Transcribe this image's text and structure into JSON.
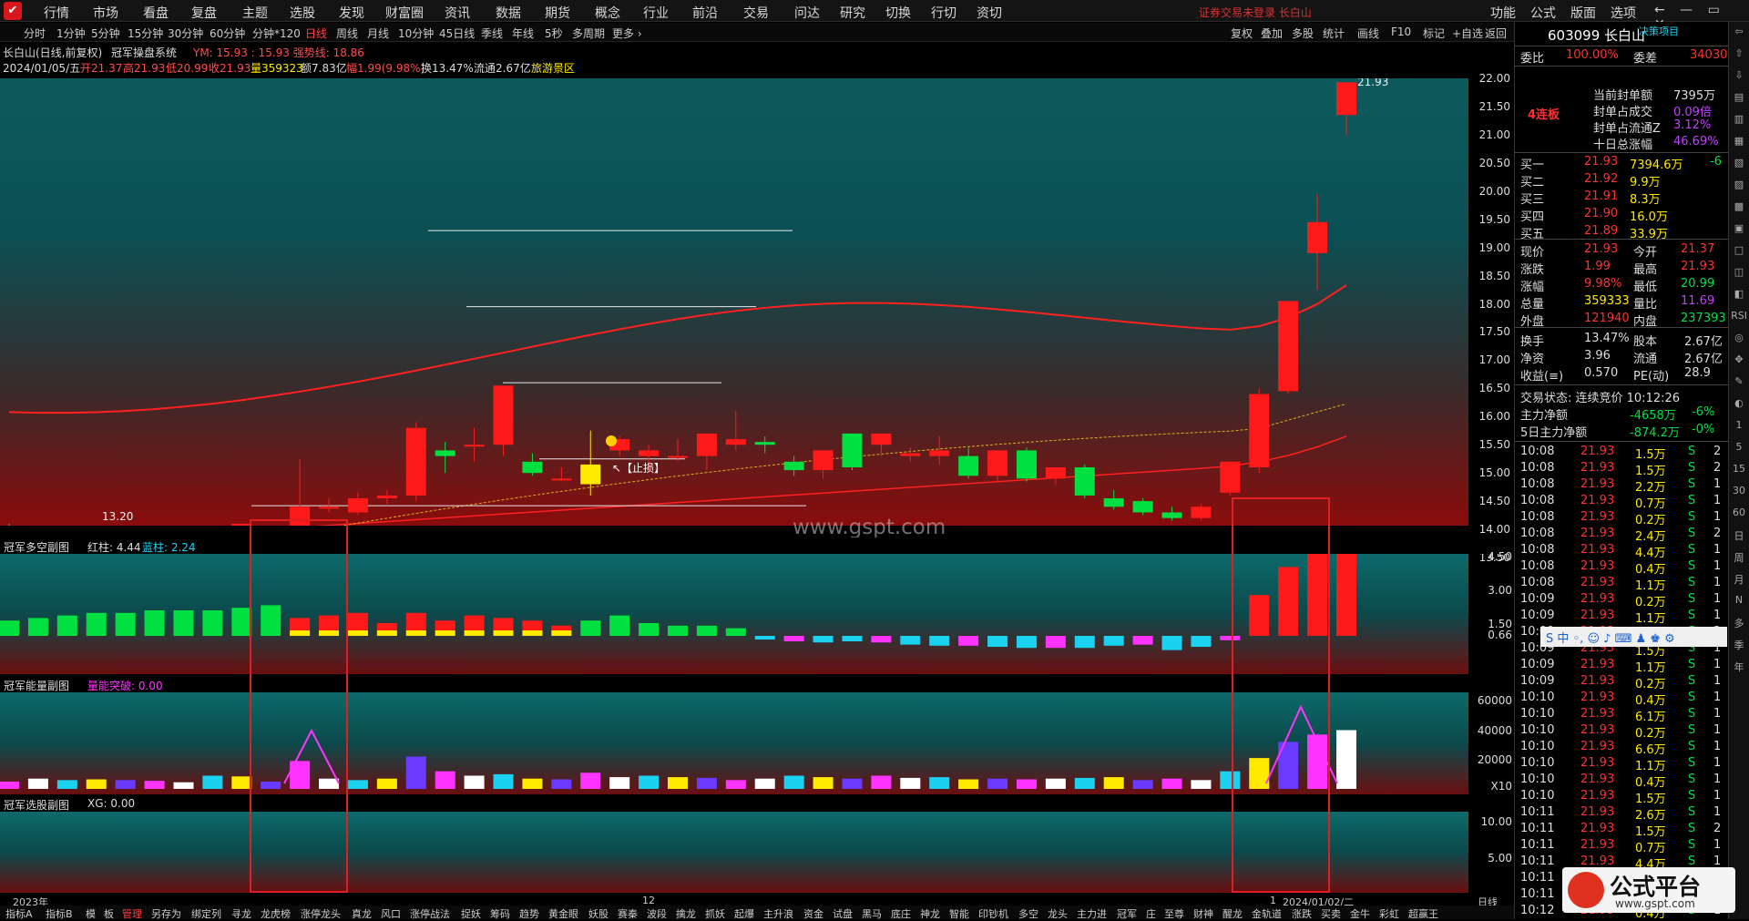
{
  "menu": {
    "logo": "✔",
    "items": [
      "行情",
      "市场",
      "看盘",
      "复盘",
      "主题",
      "选股",
      "发现",
      "财富圈",
      "资讯",
      "数据",
      "期货",
      "概念",
      "行业",
      "前沿",
      "交易",
      "问达",
      "研究",
      "切换",
      "行切",
      "资切"
    ],
    "login_warning": "证券交易未登录 长白山",
    "right_items": [
      "功能",
      "公式",
      "版面",
      "选项"
    ],
    "window_controls": "← — ▭ ✕"
  },
  "periods": [
    "分时",
    "1分钟",
    "5分钟",
    "15分钟",
    "30分钟",
    "60分钟",
    "分钟*120",
    "日线",
    "周线",
    "月线",
    "10分钟",
    "45日线",
    "季线",
    "年线",
    "5秒",
    "多周期",
    "更多 ›"
  ],
  "period_active": "日线",
  "toolbar_right": [
    "复权",
    "叠加",
    "多股",
    "统计",
    "画线",
    "F10",
    "标记",
    "+自选",
    "返回"
  ],
  "chart_title": "长白山(日线,前复权)",
  "system_name": "冠军操盘系统",
  "ym_text": "YM: 15.93 : 15.93 强势线: 18.86",
  "ohlc": {
    "date": "2024/01/05/五",
    "open": "开21.37",
    "high": "高21.93",
    "low": "低20.99",
    "close": "收21.93",
    "vol": "量359323",
    "amt": "额7.83亿",
    "chg": "幅1.99(9.98%)",
    "turn": "换13.47%",
    "float": "流通2.67亿",
    "sector": "旅游景区"
  },
  "yaxis": [
    "22.00",
    "21.50",
    "21.00",
    "20.50",
    "20.00",
    "19.50",
    "19.00",
    "18.50",
    "18.00",
    "17.50",
    "17.00",
    "16.50",
    "16.00",
    "15.50",
    "15.00",
    "14.50",
    "14.00",
    "13.50"
  ],
  "annot": {
    "max": "21.93",
    "min": "13.20",
    "stop": "↖【止损】",
    "watermark": "www.gspt.com"
  },
  "sub1": {
    "name": "冠军多空副图",
    "red": "红柱: 4.44",
    "blue": "蓝柱: 2.24",
    "y": [
      "4.50",
      "3.00",
      "1.50",
      "0.66"
    ]
  },
  "sub2": {
    "name": "冠军能量副图",
    "label": "量能突破: 0.00",
    "y": [
      "60000",
      "40000",
      "20000",
      "X10"
    ]
  },
  "sub3": {
    "name": "冠军选股副图",
    "label": "XG: 0.00",
    "y": [
      "10.00",
      "5.00"
    ]
  },
  "time_labels": [
    "2023年",
    "12",
    "1",
    "2024/01/02/二"
  ],
  "time_label_right": "日线",
  "tabs": [
    "指标A",
    "指标B",
    "模",
    "板",
    "管理",
    "另存为",
    "绑定列",
    "寻龙",
    "龙虎榜",
    "涨停龙头",
    "真龙",
    "风口",
    "涨停战法",
    "捉妖",
    "筹码",
    "趋势",
    "黄金眼",
    "妖股",
    "赛秦",
    "波段",
    "擒龙",
    "抓妖",
    "起爆",
    "主升浪",
    "资金",
    "试盘",
    "黑马",
    "底庄",
    "神龙",
    "智能",
    "印钞机",
    "多空",
    "龙头",
    "主力进",
    "冠军",
    "庄",
    "至尊",
    "财神",
    "醒龙",
    "金轨道",
    "涨跌",
    "买卖",
    "金牛",
    "彩虹",
    "超赢王"
  ],
  "side": {
    "code": "603099 长白山",
    "tag": "决策项目",
    "wb_label": "委比",
    "wb": "100.00%",
    "wc_label": "委差",
    "wc": "34030",
    "lb": "4连板",
    "seal": [
      [
        "当前封单额",
        "7395万"
      ],
      [
        "封单占成交",
        "0.09倍"
      ],
      [
        "封单占流通Z",
        "3.12%"
      ],
      [
        "十日总涨幅",
        "46.69%"
      ]
    ],
    "buys": [
      [
        "买一",
        "21.93",
        "7394.6万",
        "-6"
      ],
      [
        "买二",
        "21.92",
        "9.9万",
        ""
      ],
      [
        "买三",
        "21.91",
        "8.3万",
        ""
      ],
      [
        "买四",
        "21.90",
        "16.0万",
        ""
      ],
      [
        "买五",
        "21.89",
        "33.9万",
        ""
      ]
    ],
    "quote": [
      [
        "现价",
        "21.93",
        "今开",
        "21.37"
      ],
      [
        "涨跌",
        "1.99",
        "最高",
        "21.93"
      ],
      [
        "涨幅",
        "9.98%",
        "最低",
        "20.99"
      ],
      [
        "总量",
        "359333",
        "量比",
        "11.69"
      ],
      [
        "外盘",
        "121940",
        "内盘",
        "237393"
      ]
    ],
    "fin": [
      [
        "换手",
        "13.47%",
        "股本",
        "2.67亿"
      ],
      [
        "净资",
        "3.96",
        "流通",
        "2.67亿"
      ],
      [
        "收益(≡)",
        "0.570",
        "PE(动)",
        "28.9"
      ]
    ],
    "status": "交易状态: 连续竞价 10:12:26",
    "flows": [
      [
        "主力净额",
        "-4658万",
        "-6%"
      ],
      [
        "5日主力净额",
        "-874.2万",
        "-0%"
      ]
    ],
    "ticks": [
      [
        "10:08",
        "21.93",
        "1.5万",
        "S",
        "2"
      ],
      [
        "10:08",
        "21.93",
        "1.5万",
        "S",
        "2"
      ],
      [
        "10:08",
        "21.93",
        "2.2万",
        "S",
        "1"
      ],
      [
        "10:08",
        "21.93",
        "0.7万",
        "S",
        "1"
      ],
      [
        "10:08",
        "21.93",
        "0.2万",
        "S",
        "1"
      ],
      [
        "10:08",
        "21.93",
        "2.4万",
        "S",
        "2"
      ],
      [
        "10:08",
        "21.93",
        "4.4万",
        "S",
        "1"
      ],
      [
        "10:08",
        "21.93",
        "0.4万",
        "S",
        "1"
      ],
      [
        "10:08",
        "21.93",
        "1.1万",
        "S",
        "1"
      ],
      [
        "10:09",
        "21.93",
        "0.2万",
        "S",
        "1"
      ],
      [
        "10:09",
        "21.93",
        "1.1万",
        "S",
        "1"
      ],
      [
        "10:09",
        "21.93",
        "6.8万",
        "S",
        "2"
      ],
      [
        "10:09",
        "21.93",
        "1.5万",
        "S",
        "1"
      ],
      [
        "10:09",
        "21.93",
        "1.1万",
        "S",
        "1"
      ],
      [
        "10:09",
        "21.93",
        "0.2万",
        "S",
        "1"
      ],
      [
        "10:10",
        "21.93",
        "0.4万",
        "S",
        "1"
      ],
      [
        "10:10",
        "21.93",
        "6.1万",
        "S",
        "1"
      ],
      [
        "10:10",
        "21.93",
        "0.2万",
        "S",
        "1"
      ],
      [
        "10:10",
        "21.93",
        "6.6万",
        "S",
        "1"
      ],
      [
        "10:10",
        "21.93",
        "1.1万",
        "S",
        "1"
      ],
      [
        "10:10",
        "21.93",
        "0.4万",
        "S",
        "1"
      ],
      [
        "10:10",
        "21.93",
        "1.5万",
        "S",
        "1"
      ],
      [
        "10:11",
        "21.93",
        "2.6万",
        "S",
        "1"
      ],
      [
        "10:11",
        "21.93",
        "1.5万",
        "S",
        "2"
      ],
      [
        "10:11",
        "21.93",
        "0.7万",
        "S",
        "1"
      ],
      [
        "10:11",
        "21.93",
        "4.4万",
        "S",
        "1"
      ],
      [
        "10:11",
        "21.93",
        "0.2万",
        "S",
        "1"
      ],
      [
        "10:11",
        "21.93",
        "1.1万",
        "S",
        "1"
      ],
      [
        "10:12",
        "21.93",
        "0.4万",
        "S",
        "1"
      ]
    ]
  },
  "tools": [
    "⇦",
    "⇧",
    "⇩",
    "▤",
    "▥",
    "▦",
    "▧",
    "▨",
    "▩",
    "▣",
    "□",
    "◫",
    "◧",
    "RSI",
    "◎",
    "✥",
    "✎",
    "◐",
    "1",
    "5",
    "15",
    "30",
    "60",
    "日",
    "周",
    "月",
    "N",
    "多",
    "季",
    "年"
  ],
  "ime_bar": "S 中 ◦, ☺ ♪ ⌨ ♟ ♚ ⚙",
  "logo_badge": {
    "title": "公式平台",
    "url": "www.gspt.com"
  },
  "colors": {
    "up": "#ff1a1a",
    "down": "#00e040",
    "yellow": "#ffea00",
    "cyan": "#1ad2f0",
    "magenta": "#ff33ff"
  },
  "chart_data": {
    "type": "candlestick",
    "ylim": [
      13.2,
      22.3
    ],
    "ohlc": [
      [
        14.05,
        14.1,
        13.85,
        13.75
      ],
      [
        13.85,
        13.95,
        13.75,
        13.7
      ],
      [
        13.8,
        13.85,
        13.75,
        13.7
      ],
      [
        13.8,
        13.85,
        13.95,
        13.2
      ],
      [
        13.9,
        14.0,
        13.75,
        13.65
      ],
      [
        13.7,
        13.8,
        13.55,
        13.45
      ],
      [
        13.6,
        13.7,
        13.6,
        13.4
      ],
      [
        13.8,
        13.95,
        14.05,
        13.7
      ],
      [
        13.95,
        14.1,
        14.1,
        13.8
      ],
      [
        13.9,
        13.95,
        13.85,
        13.75
      ],
      [
        13.9,
        15.25,
        14.4,
        13.85
      ],
      [
        14.4,
        14.55,
        14.4,
        14.3
      ],
      [
        14.3,
        14.65,
        14.55,
        14.25
      ],
      [
        14.55,
        14.7,
        14.6,
        14.45
      ],
      [
        14.6,
        15.9,
        15.8,
        14.5
      ],
      [
        15.4,
        15.55,
        15.3,
        15.0
      ],
      [
        15.5,
        15.8,
        15.5,
        15.2
      ],
      [
        15.5,
        16.5,
        16.55,
        15.3
      ],
      [
        15.2,
        15.35,
        15.0,
        14.95
      ],
      [
        14.9,
        15.1,
        14.9,
        14.85
      ],
      [
        15.15,
        15.75,
        14.8,
        14.6
      ],
      [
        15.4,
        15.65,
        15.6,
        15.3
      ],
      [
        15.3,
        15.5,
        15.4,
        15.05
      ],
      [
        15.3,
        15.6,
        15.3,
        15.2
      ],
      [
        15.3,
        15.65,
        15.7,
        15.05
      ],
      [
        15.5,
        16.1,
        15.6,
        15.4
      ],
      [
        15.55,
        15.65,
        15.5,
        15.35
      ],
      [
        15.2,
        15.3,
        15.05,
        14.95
      ],
      [
        15.05,
        15.2,
        15.4,
        14.9
      ],
      [
        15.7,
        15.5,
        15.1,
        15.05
      ],
      [
        15.5,
        15.6,
        15.7,
        15.3
      ],
      [
        15.3,
        15.45,
        15.35,
        15.2
      ],
      [
        15.3,
        15.65,
        15.4,
        15.15
      ],
      [
        15.3,
        15.45,
        14.95,
        14.9
      ],
      [
        14.95,
        15.4,
        15.4,
        14.85
      ],
      [
        15.4,
        15.45,
        14.9,
        14.85
      ],
      [
        14.9,
        14.95,
        15.1,
        14.8
      ],
      [
        15.1,
        15.15,
        14.6,
        14.55
      ],
      [
        14.55,
        14.7,
        14.4,
        14.35
      ],
      [
        14.5,
        14.55,
        14.3,
        14.25
      ],
      [
        14.3,
        14.4,
        14.2,
        14.15
      ],
      [
        14.2,
        14.45,
        14.4,
        14.15
      ],
      [
        14.65,
        15.2,
        15.2,
        14.6
      ],
      [
        15.1,
        16.5,
        16.4,
        15.0
      ],
      [
        16.45,
        18.05,
        18.05,
        16.4
      ],
      [
        18.9,
        19.95,
        19.45,
        18.25
      ],
      [
        21.35,
        21.93,
        21.93,
        20.99
      ]
    ],
    "sub1": [
      0.6,
      0.7,
      0.8,
      0.9,
      0.9,
      1.0,
      1.0,
      1.0,
      1.1,
      1.2,
      0.7,
      0.8,
      0.9,
      0.5,
      0.9,
      0.6,
      0.8,
      0.7,
      0.6,
      0.4,
      0.6,
      0.8,
      0.5,
      0.4,
      0.4,
      0.3,
      0.5,
      0.7,
      0.8,
      0.7,
      0.8,
      1.0,
      1.1,
      1.1,
      1.2,
      1.3,
      1.3,
      1.3,
      1.1,
      1.0,
      1.5,
      1.2,
      0.6,
      1.6,
      2.7,
      4.4,
      4.5
    ],
    "sub2": [
      5000,
      7000,
      6000,
      6500,
      6000,
      5500,
      4500,
      9000,
      8500,
      5000,
      19000,
      7000,
      6000,
      7000,
      22000,
      12000,
      9000,
      10000,
      7000,
      6500,
      11000,
      8000,
      9000,
      8000,
      7500,
      6000,
      7000,
      9000,
      8000,
      7000,
      9000,
      7500,
      8000,
      6500,
      7000,
      6500,
      7000,
      7500,
      8000,
      6000,
      7000,
      6000,
      12000,
      21000,
      32000,
      37000,
      40000
    ]
  }
}
